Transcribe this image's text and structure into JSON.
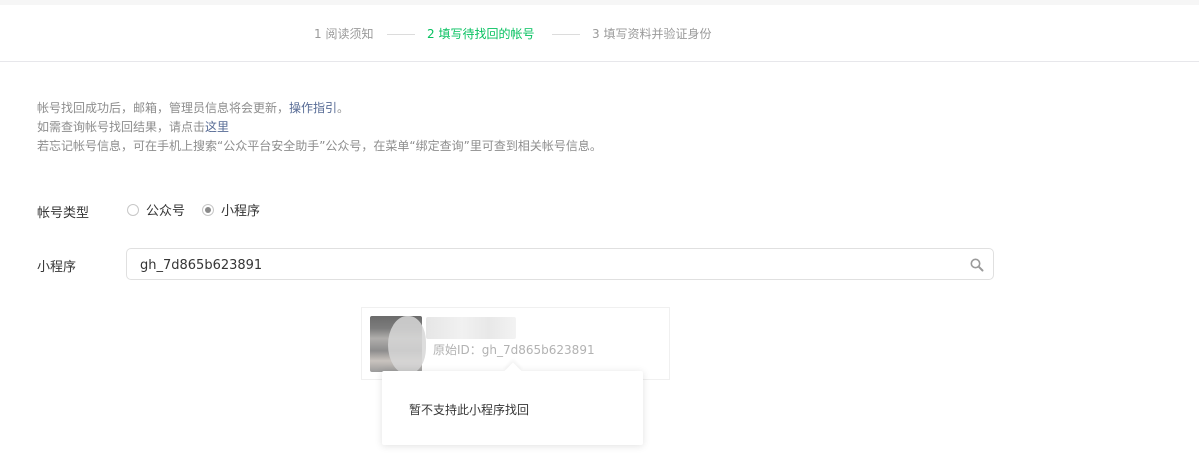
{
  "steps": [
    {
      "label": "1 阅读须知",
      "active": false
    },
    {
      "label": "2 填写待找回的帐号",
      "active": true
    },
    {
      "label": "3 填写资料并验证身份",
      "active": false
    }
  ],
  "tips": {
    "line1_text": "帐号找回成功后，邮箱，管理员信息将会更新，",
    "line1_link": "操作指引",
    "line1_end": "。",
    "line2_text": "如需查询帐号找回结果，请点击",
    "line2_link": "这里",
    "line3_text": "若忘记帐号信息，可在手机上搜索“公众平台安全助手”公众号，在菜单“绑定查询”里可查到相关帐号信息。"
  },
  "account_type": {
    "label": "帐号类型",
    "options": [
      {
        "label": "公众号",
        "checked": false
      },
      {
        "label": "小程序",
        "checked": true
      }
    ]
  },
  "search": {
    "label": "小程序",
    "value": "gh_7d865b623891"
  },
  "result": {
    "original_id": "原始ID：gh_7d865b623891"
  },
  "tooltip": {
    "text": "暂不支持此小程序找回"
  },
  "colors": {
    "active_step": "#07c160",
    "link": "#576b95",
    "muted": "#8d8d8d"
  }
}
